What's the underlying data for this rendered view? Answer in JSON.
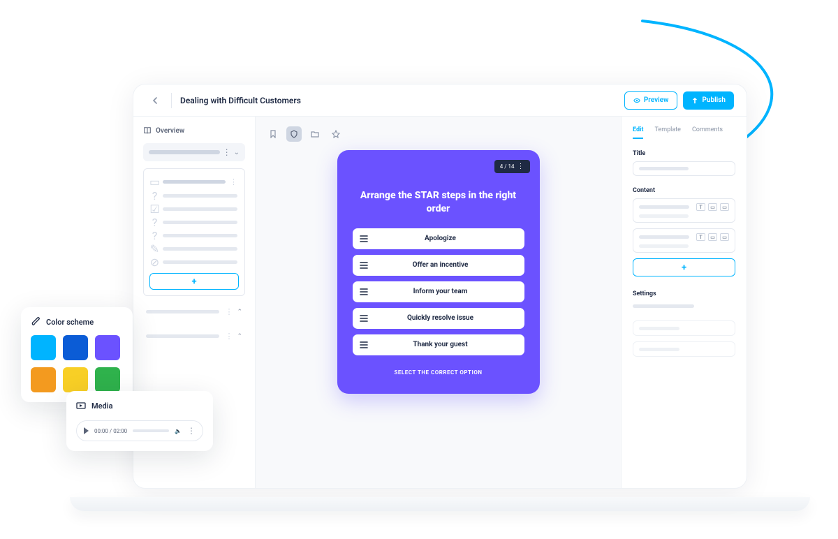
{
  "header": {
    "title": "Dealing with Difficult Customers",
    "preview_label": "Preview",
    "publish_label": "Publish"
  },
  "sidebar": {
    "overview_label": "Overview"
  },
  "card": {
    "tag": "4 / 14",
    "heading": "Arrange the STAR steps in the right order",
    "options": [
      "Apologize",
      "Offer an incentive",
      "Inform your team",
      "Quickly resolve issue",
      "Thank your guest"
    ],
    "cta": "SELECT THE CORRECT OPTION"
  },
  "rpanel": {
    "tabs": {
      "edit": "Edit",
      "template": "Template",
      "comments": "Comments"
    },
    "title_label": "Title",
    "content_label": "Content",
    "settings_label": "Settings"
  },
  "color_panel": {
    "title": "Color scheme",
    "swatches": [
      "#00b4ff",
      "#0b5cd6",
      "#6b52ff",
      "#f39a1f",
      "#f8cf26",
      "#2fb24c"
    ]
  },
  "media_panel": {
    "title": "Media",
    "time": "00:00 / 02:00"
  }
}
